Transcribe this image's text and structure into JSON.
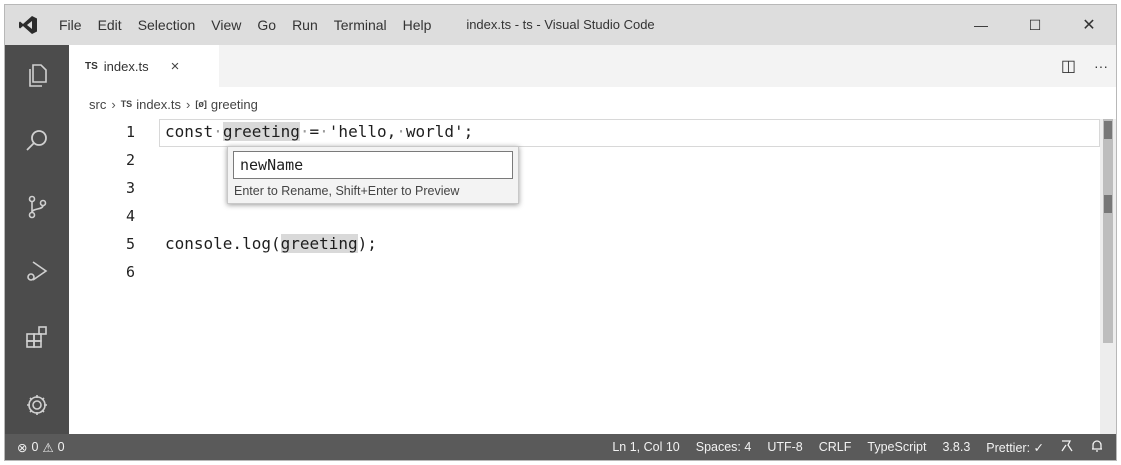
{
  "window": {
    "title": "index.ts - ts - Visual Studio Code",
    "menu": [
      "File",
      "Edit",
      "Selection",
      "View",
      "Go",
      "Run",
      "Terminal",
      "Help"
    ],
    "controls": {
      "minimize": "—",
      "maximize": "☐",
      "close": "✕"
    }
  },
  "activity_bar": [
    "explorer-icon",
    "search-icon",
    "source-control-icon",
    "run-debug-icon",
    "extensions-icon",
    "settings-gear-icon"
  ],
  "tabs": [
    {
      "badge": "TS",
      "label": "index.ts",
      "close": "×"
    }
  ],
  "editor_actions": {
    "split": "◫",
    "more": "···"
  },
  "breadcrumb": {
    "folder": "src",
    "file_badge": "TS",
    "file": "index.ts",
    "symbol_icon": "[ø]",
    "symbol": "greeting",
    "separator": "›"
  },
  "code": {
    "line_numbers": [
      "1",
      "2",
      "3",
      "4",
      "5",
      "6"
    ],
    "line1": {
      "kw": "const",
      "var": "greeting",
      "eq": "=",
      "str1": "'hello,",
      "str2": "world';"
    },
    "line5": {
      "pre": "console.log(",
      "var": "greeting",
      "post": ");"
    }
  },
  "rename_widget": {
    "value": "newName",
    "hint": "Enter to Rename, Shift+Enter to Preview"
  },
  "status_bar": {
    "errors": "0",
    "warnings": "0",
    "position": "Ln 1, Col 10",
    "spaces": "Spaces: 4",
    "encoding": "UTF-8",
    "eol": "CRLF",
    "language": "TypeScript",
    "version": "3.8.3",
    "prettier": "Prettier: ✓"
  },
  "colors": {
    "titlebar": "#dddddd",
    "activitybar": "#4c4c4c",
    "statusbar": "#5a5a5a",
    "word_highlight": "#d9d9d9"
  }
}
